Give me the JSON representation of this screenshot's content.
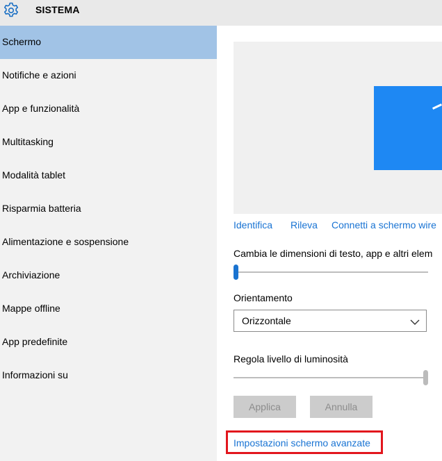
{
  "header": {
    "title": "SISTEMA",
    "icon": "gear-icon"
  },
  "sidebar": {
    "items": [
      {
        "label": "Schermo",
        "active": true
      },
      {
        "label": "Notifiche e azioni"
      },
      {
        "label": "App e funzionalità"
      },
      {
        "label": "Multitasking"
      },
      {
        "label": "Modalità tablet"
      },
      {
        "label": "Risparmia batteria"
      },
      {
        "label": "Alimentazione e sospensione"
      },
      {
        "label": "Archiviazione"
      },
      {
        "label": "Mappe offline"
      },
      {
        "label": "App predefinite"
      },
      {
        "label": "Informazioni su"
      }
    ]
  },
  "display": {
    "links": {
      "identify": "Identifica",
      "detect": "Rileva",
      "connect": "Connetti a schermo wire"
    },
    "scale_label": "Cambia le dimensioni di testo, app e altri elem",
    "scale_level": 0,
    "orientation_label": "Orientamento",
    "orientation_value": "Orizzontale",
    "brightness_label": "Regola livello di luminosità",
    "brightness_level": 100,
    "apply_label": "Applica",
    "cancel_label": "Annulla",
    "advanced_link": "Impostazioni schermo avanzate"
  },
  "colors": {
    "accent": "#1873d3",
    "selected_nav": "#a1c3e6",
    "monitor": "#1e88f3",
    "highlight_box": "#e2161d"
  }
}
